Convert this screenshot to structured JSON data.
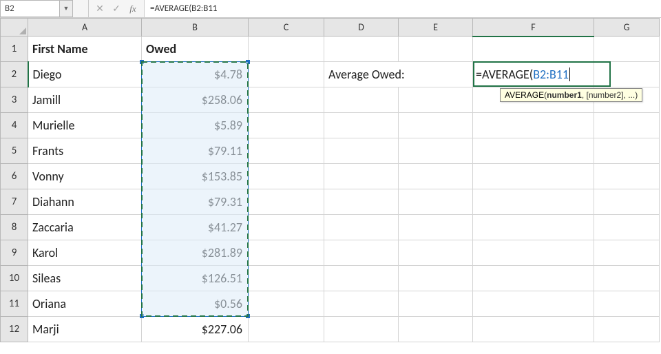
{
  "nameBox": "B2",
  "formulaBar": "=AVERAGE(B2:B11",
  "columns": [
    "A",
    "B",
    "C",
    "D",
    "E",
    "F",
    "G"
  ],
  "rows": [
    "1",
    "2",
    "3",
    "4",
    "5",
    "6",
    "7",
    "8",
    "9",
    "10",
    "11",
    "12"
  ],
  "headers": {
    "A": "First Name",
    "B": "Owed"
  },
  "data": {
    "names": [
      "Diego",
      "Jamill",
      "Murielle",
      "Frants",
      "Vonny",
      "Diahann",
      "Zaccaria",
      "Karol",
      "Sileas",
      "Oriana",
      "Marji"
    ],
    "owed": [
      "$4.78",
      "$258.06",
      "$5.89",
      "$79.11",
      "$153.85",
      "$79.31",
      "$41.27",
      "$281.89",
      "$126.51",
      "$0.56",
      "$227.06"
    ]
  },
  "labelD2": "Average Owed:",
  "editingFormula": {
    "fn": "=AVERAGE(",
    "ref": "B2:B11"
  },
  "tooltip": {
    "name": "AVERAGE",
    "sig1": "number1",
    "sig2": ", [number2], ...)"
  }
}
